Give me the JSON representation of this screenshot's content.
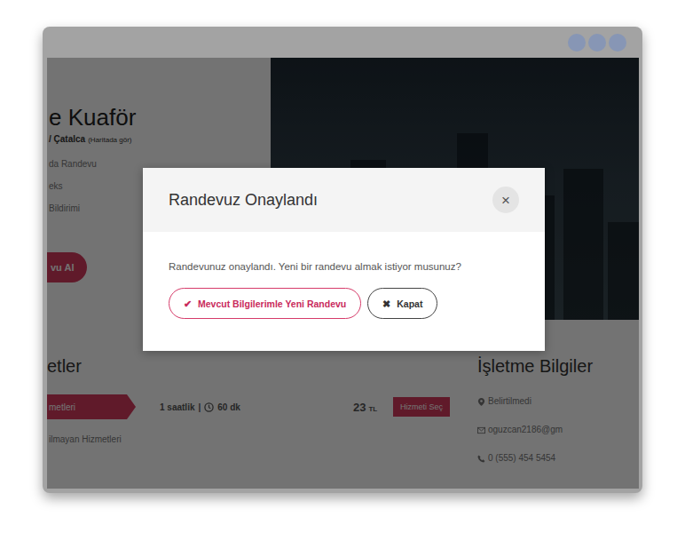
{
  "page": {
    "title": "e Kuaför",
    "location": "/ Çatalca",
    "map_link": "(Haritada gör)",
    "features": [
      "da Randevu",
      "eks",
      "Bildirimi"
    ],
    "cta": "vu Al",
    "services_heading": "etler",
    "service_tabs": [
      {
        "label": "metleri",
        "selected": true
      },
      {
        "label": "ilmayan Hizmetleri",
        "selected": false
      }
    ],
    "service": {
      "duration": "1 saatlik",
      "separator": "|",
      "time": "60 dk",
      "price": "23",
      "currency": "TL",
      "button": "Hizmeti Seç"
    },
    "business": {
      "heading": "İşletme Bilgiler",
      "address": "Belirtilmedi",
      "email": "oguzcan2186@gm",
      "phone": "0 (555) 454 5454"
    }
  },
  "modal": {
    "title": "Randevuz Onaylandı",
    "close": "×",
    "message": "Randevunuz onaylandı. Yeni bir randevu almak istiyor musunuz?",
    "buttons": [
      {
        "icon": "✔",
        "label": "Mevcut Bilgilerimle Yeni Randevu",
        "kind": "primary"
      },
      {
        "icon": "✖",
        "label": "Kapat",
        "kind": "secondary"
      }
    ]
  }
}
